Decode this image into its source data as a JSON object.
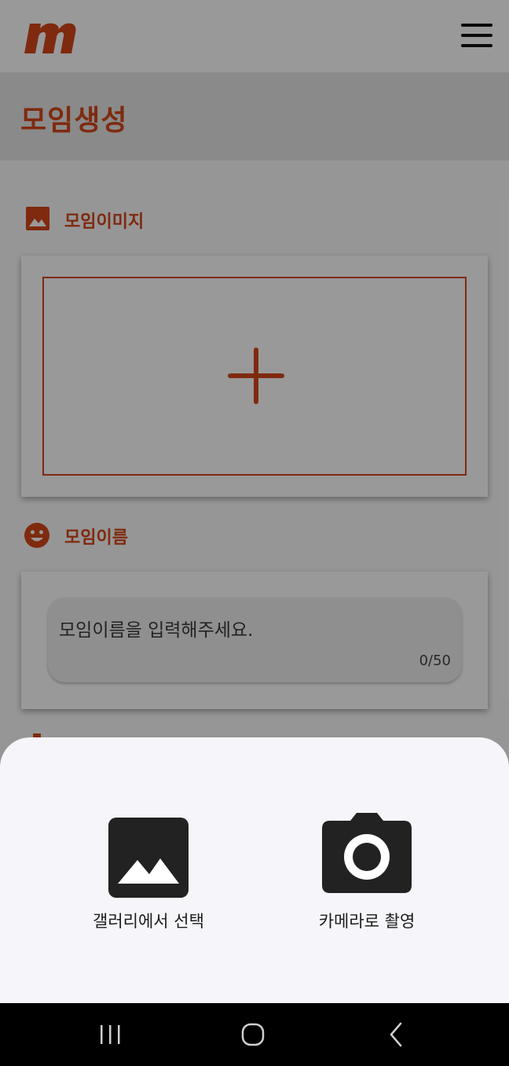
{
  "header": {
    "logo_icon": "brand-m-logo-icon",
    "menu_icon": "hamburger-menu-icon"
  },
  "page": {
    "title": "모임생성"
  },
  "sections": {
    "image": {
      "label": "모임이미지",
      "icon": "image-icon",
      "add_icon": "plus-icon"
    },
    "name": {
      "label": "모임이름",
      "icon": "smiley-face-icon",
      "placeholder": "모임이름을 입력해주세요.",
      "counter": "0/50"
    }
  },
  "bottom_sheet": {
    "options": [
      {
        "label": "갤러리에서 선택",
        "icon": "gallery-image-icon"
      },
      {
        "label": "카메라로 촬영",
        "icon": "camera-icon"
      }
    ]
  },
  "navbar": {
    "buttons": [
      "recent-apps-icon",
      "home-icon",
      "back-icon"
    ]
  },
  "colors": {
    "accent": "#d4471a",
    "sheet_bg": "#f6f5fa",
    "icon_dark": "#222222",
    "navbar_bg": "#000000"
  }
}
